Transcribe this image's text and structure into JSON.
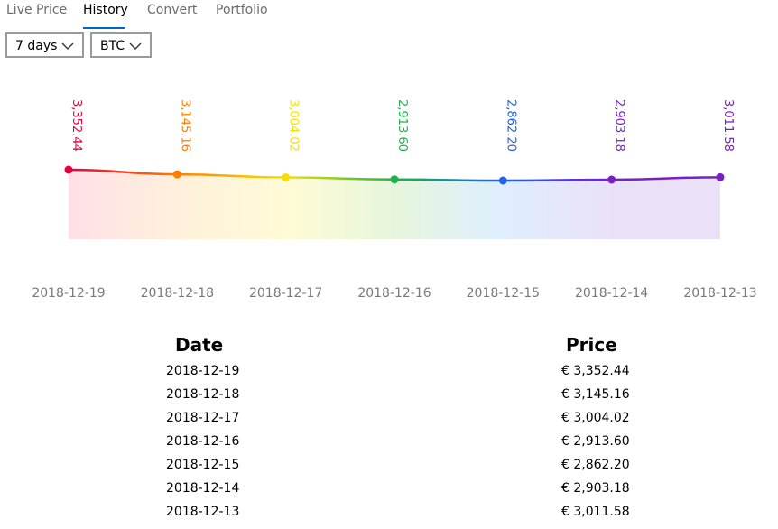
{
  "tabs": [
    {
      "label": "Live Price",
      "active": false
    },
    {
      "label": "History",
      "active": true
    },
    {
      "label": "Convert",
      "active": false
    },
    {
      "label": "Portfolio",
      "active": false
    }
  ],
  "filters": {
    "range": "7 days",
    "coin": "BTC"
  },
  "chart_data": {
    "type": "line",
    "categories": [
      "2018-12-19",
      "2018-12-18",
      "2018-12-17",
      "2018-12-16",
      "2018-12-15",
      "2018-12-14",
      "2018-12-13"
    ],
    "values": [
      3352.44,
      3145.16,
      3004.02,
      2913.6,
      2862.2,
      2903.18,
      3011.58
    ],
    "data_labels": [
      "3,352.44",
      "3,145.16",
      "3,004.02",
      "2,913.60",
      "2,862.20",
      "2,903.18",
      "3,011.58"
    ],
    "point_colors": [
      "#e8003c",
      "#ff7f00",
      "#f5e100",
      "#1db34a",
      "#2162e8",
      "#7a1fc2",
      "#7a1fc2"
    ],
    "fill_colors": [
      "#ffe0e6",
      "#fff0dc",
      "#fffbd6",
      "#e6f6dc",
      "#dfeeff",
      "#ebe1f6",
      "#ebe1f6"
    ],
    "title": "",
    "xlabel": "",
    "ylabel": "",
    "grid": false
  },
  "table": {
    "headers": {
      "date": "Date",
      "price": "Price"
    },
    "rows": [
      {
        "date": "2018-12-19",
        "price": "€ 3,352.44"
      },
      {
        "date": "2018-12-18",
        "price": "€ 3,145.16"
      },
      {
        "date": "2018-12-17",
        "price": "€ 3,004.02"
      },
      {
        "date": "2018-12-16",
        "price": "€ 2,913.60"
      },
      {
        "date": "2018-12-15",
        "price": "€ 2,862.20"
      },
      {
        "date": "2018-12-14",
        "price": "€ 2,903.18"
      },
      {
        "date": "2018-12-13",
        "price": "€ 3,011.58"
      }
    ]
  }
}
